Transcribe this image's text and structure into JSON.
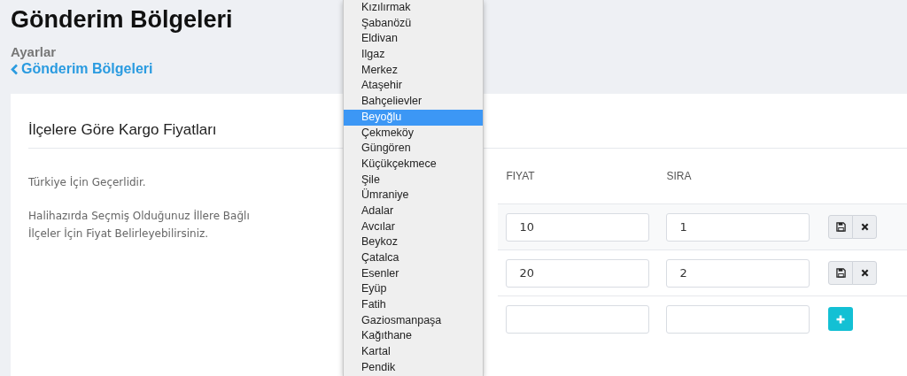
{
  "page": {
    "title": "Gönderim Bölgeleri",
    "breadcrumb": "Ayarlar",
    "back_link": "Gönderim Bölgeleri"
  },
  "card": {
    "title": "İlçelere Göre Kargo Fiyatları",
    "notes": [
      "Türkiye İçin Geçerlidir.",
      "Halihazırda Seçmiş Olduğunuz İllere Bağlı İlçeler İçin Fiyat Belirleyebilirsiniz."
    ],
    "table": {
      "columns": [
        "FIYAT",
        "SIRA"
      ],
      "rows": [
        {
          "kind": "saved",
          "price": "10",
          "order": "1"
        },
        {
          "kind": "saved",
          "price": "20",
          "order": "2"
        },
        {
          "kind": "new",
          "price": "",
          "order": ""
        }
      ]
    }
  },
  "dropdown": {
    "options": [
      {
        "label": "Kızılırmak",
        "selected": false
      },
      {
        "label": "Şabanözü",
        "selected": false
      },
      {
        "label": "Eldivan",
        "selected": false
      },
      {
        "label": "Ilgaz",
        "selected": false
      },
      {
        "label": "Merkez",
        "selected": false
      },
      {
        "label": "Ataşehir",
        "selected": false
      },
      {
        "label": "Bahçelievler",
        "selected": false
      },
      {
        "label": "Beyoğlu",
        "selected": true
      },
      {
        "label": "Çekmeköy",
        "selected": false
      },
      {
        "label": "Güngören",
        "selected": false
      },
      {
        "label": "Küçükçekmece",
        "selected": false
      },
      {
        "label": "Şile",
        "selected": false
      },
      {
        "label": "Ümraniye",
        "selected": false
      },
      {
        "label": "Adalar",
        "selected": false
      },
      {
        "label": "Avcılar",
        "selected": false
      },
      {
        "label": "Beykoz",
        "selected": false
      },
      {
        "label": "Çatalca",
        "selected": false
      },
      {
        "label": "Esenler",
        "selected": false
      },
      {
        "label": "Eyüp",
        "selected": false
      },
      {
        "label": "Fatih",
        "selected": false
      },
      {
        "label": "Gaziosmanpaşa",
        "selected": false
      },
      {
        "label": "Kağıthane",
        "selected": false
      },
      {
        "label": "Kartal",
        "selected": false
      },
      {
        "label": "Pendik",
        "selected": false
      }
    ]
  }
}
